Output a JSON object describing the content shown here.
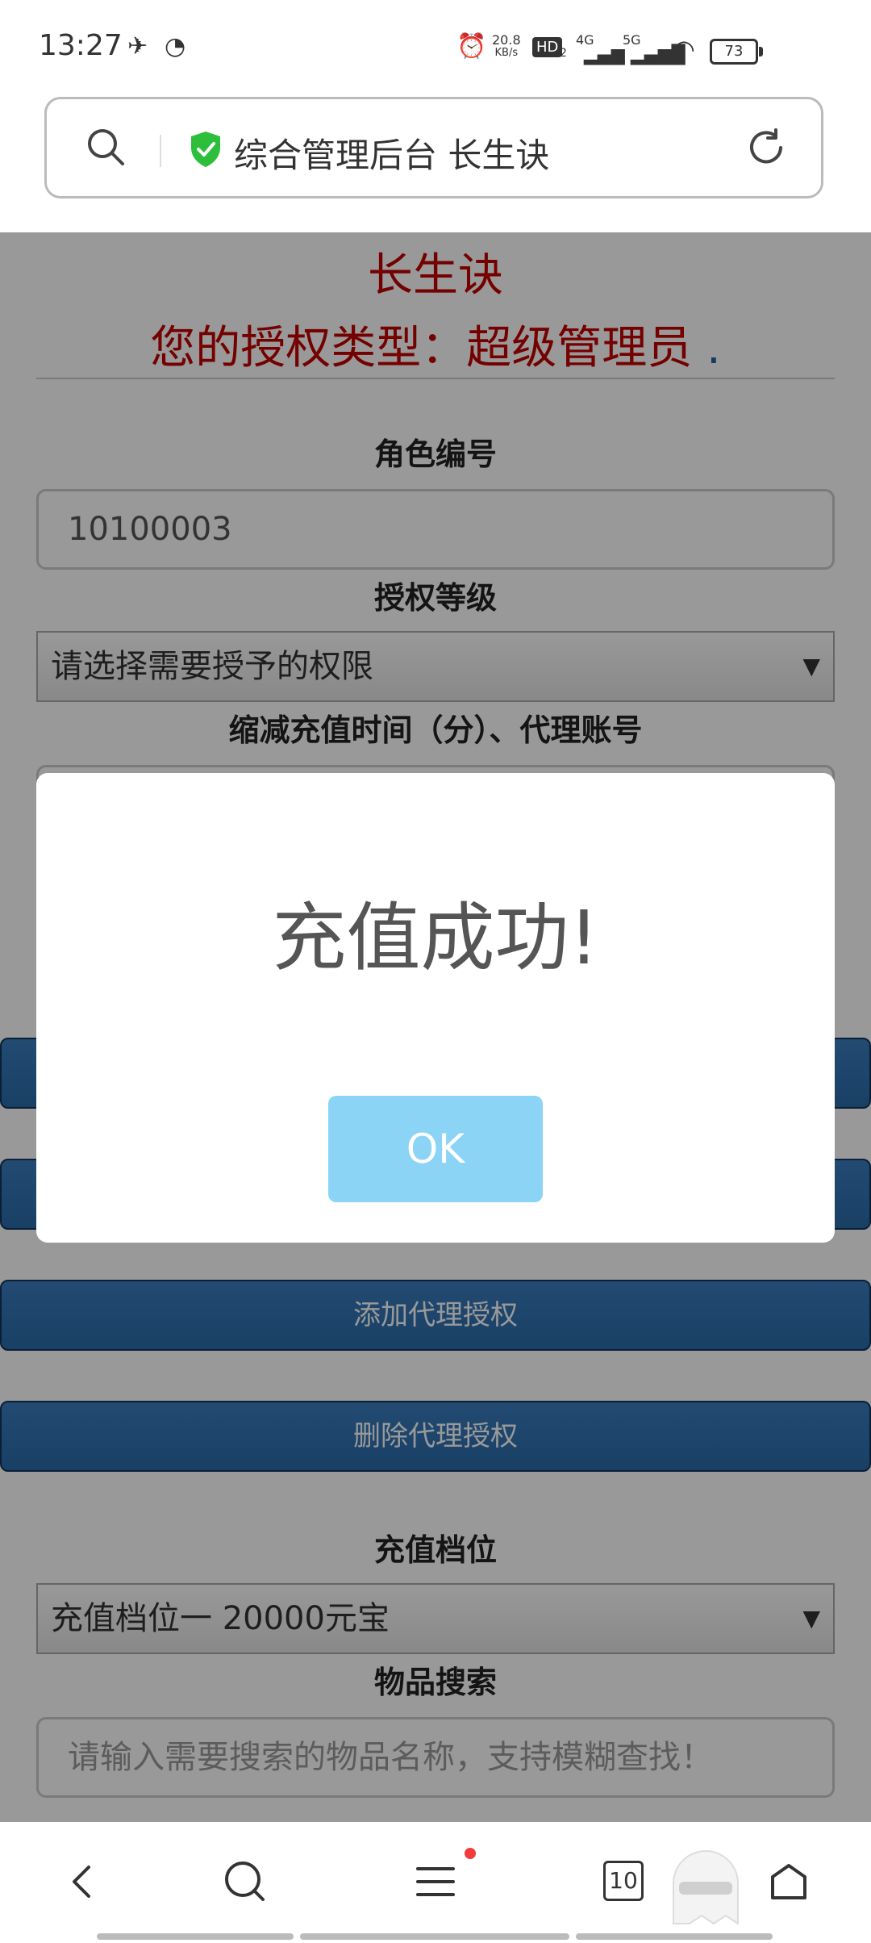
{
  "status_bar": {
    "time": "13:27",
    "speed_value": "20.8",
    "speed_unit": "KB/s",
    "hd_label": "HD",
    "hd_num": "2",
    "net1": "4G",
    "net2": "5G",
    "battery": "73"
  },
  "address_bar": {
    "title": "综合管理后台 长生诀"
  },
  "page": {
    "heading": "长生诀",
    "auth_type_line": "您的授权类型：超级管理员",
    "auth_dot": ".",
    "role_id_label": "角色编号",
    "role_id_value": "10100003",
    "auth_level_label": "授权等级",
    "auth_level_selected": "请选择需要授予的权限",
    "reduce_time_label": "缩减充值时间（分）、代理账号",
    "add_agent_button": "添加代理授权",
    "delete_agent_button": "删除代理授权",
    "recharge_tier_label": "充值档位",
    "recharge_tier_selected": "充值档位一 20000元宝",
    "item_search_label": "物品搜索",
    "item_search_placeholder": "请输入需要搜索的物品名称，支持模糊查找！"
  },
  "dialog": {
    "message": "充值成功!",
    "ok_button": "OK"
  },
  "bottom_nav": {
    "tabs_count": "10"
  },
  "colors": {
    "heading_red": "#c40000",
    "button_blue": "#2a6aa8",
    "ok_button": "#8cd4f5"
  },
  "icons": [
    "search-icon",
    "shield-icon",
    "reload-icon",
    "back-icon",
    "menu-icon",
    "tabs-icon",
    "home-icon",
    "ghost-icon"
  ]
}
